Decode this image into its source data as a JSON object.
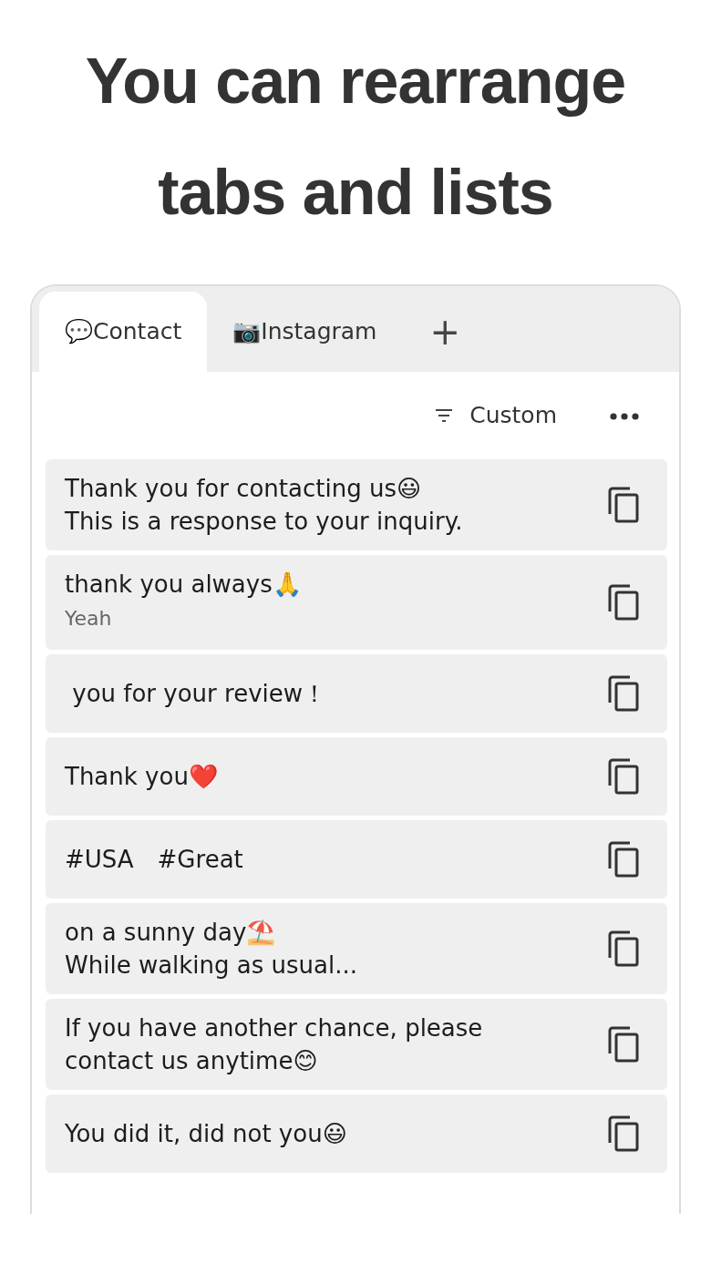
{
  "headline": [
    "You can rearrange",
    "tabs and lists"
  ],
  "tabs": [
    {
      "icon": "💬",
      "label": "Contact",
      "selected": true
    },
    {
      "icon": "📷",
      "label": "Instagram",
      "selected": false
    }
  ],
  "add_tab": "+",
  "sort": {
    "label": "Custom"
  },
  "items": [
    {
      "lines": [
        "Thank you for contacting us😃",
        "This is a response to your inquiry."
      ]
    },
    {
      "lines": [
        "thank you always🙏"
      ],
      "note": "Yeah"
    },
    {
      "lines": [
        " you for your review！"
      ]
    },
    {
      "lines": [
        "Thank you❤️"
      ]
    },
    {
      "lines": [
        "#USA　#Great"
      ]
    },
    {
      "lines": [
        "on a sunny day⛱️",
        "While walking as usual..."
      ]
    },
    {
      "lines": [
        "If you have another chance, please",
        "contact us anytime😊"
      ]
    },
    {
      "lines": [
        "You did it, did not you😃"
      ]
    }
  ]
}
